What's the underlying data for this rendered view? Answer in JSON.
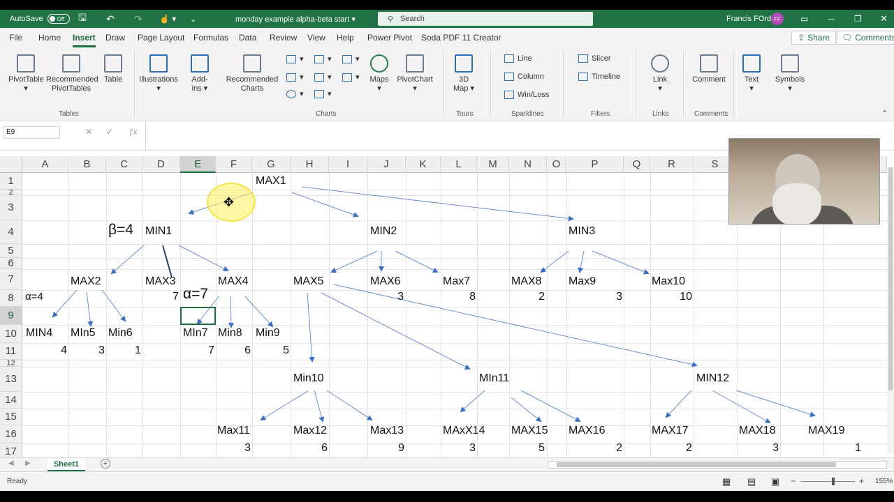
{
  "titlebar": {
    "autosave_label": "AutoSave",
    "autosave_state": "Off",
    "doc_title": "monday example alpha-beta start ▾",
    "search_placeholder": "Search",
    "user_name": "Francis FOrd",
    "user_initials": "FF"
  },
  "menu": [
    "File",
    "Home",
    "Insert",
    "Draw",
    "Page Layout",
    "Formulas",
    "Data",
    "Review",
    "View",
    "Help",
    "Power Pivot",
    "Soda PDF 11 Creator"
  ],
  "share_label": "Share",
  "comments_label": "Comments",
  "ribbon": {
    "pivottable": "PivotTable",
    "recommended_pivot": [
      "Recommended",
      "PivotTables"
    ],
    "table": "Table",
    "illustrations": "Illustrations",
    "addins": [
      "Add-",
      "ins ▾"
    ],
    "recommended_charts": [
      "Recommended",
      "Charts"
    ],
    "maps": "Maps",
    "pivotchart": "PivotChart",
    "map3d": [
      "3D",
      "Map ▾"
    ],
    "line": "Line",
    "column": "Column",
    "winloss": "Win/Loss",
    "slicer": "Slicer",
    "timeline": "Timeline",
    "link": "Link",
    "comment": "Comment",
    "text": "Text",
    "symbols": "Symbols",
    "groups": {
      "tables": "Tables",
      "charts": "Charts",
      "tours": "Tours",
      "sparklines": "Sparklines",
      "filters": "Filters",
      "links": "Links",
      "comments": "Comments"
    }
  },
  "namebox": "E9",
  "columns": [
    "A",
    "B",
    "C",
    "D",
    "E",
    "F",
    "G",
    "H",
    "I",
    "J",
    "K",
    "L",
    "M",
    "N",
    "O",
    "P",
    "Q",
    "R",
    "S"
  ],
  "rows": [
    "1",
    "2",
    "3",
    "4",
    "5",
    "6",
    "7",
    "8",
    "9",
    "10",
    "11",
    "12",
    "13",
    "14",
    "15",
    "16",
    "17"
  ],
  "cells": {
    "max1": "MAX1",
    "beta": "β=4",
    "min1": "MIN1",
    "min2": "MIN2",
    "min3": "MIN3",
    "max2": "MAX2",
    "max3": "MAX3",
    "max4": "MAX4",
    "max5": "MAX5",
    "max6": "MAX6",
    "max7": "Max7",
    "max8": "MAX8",
    "max9": "Max9",
    "max10": "Max10",
    "alpha4": "α=4",
    "d8": "7",
    "alpha7": "α=7",
    "j8": "3",
    "l8": "8",
    "n8": "2",
    "p8": "3",
    "r8": "10",
    "min4": "MIN4",
    "min5": "MIn5",
    "min6": "Min6",
    "min7": "MIn7",
    "min8": "Min8",
    "min9": "Min9",
    "a11": "4",
    "b11": "3",
    "c11": "1",
    "e11": "7",
    "f11": "6",
    "g11": "5",
    "min10": "Min10",
    "min11": "MIn11",
    "min12": "MIN12",
    "max11": "Max11",
    "max12": "Max12",
    "max13": "Max13",
    "max14": "MAxX14",
    "max15": "MAX15",
    "max16": "MAX16",
    "max17": "MAX17",
    "max18": "MAX18",
    "max19": "MAX19",
    "f17": "3",
    "h17": "6",
    "j17": "9",
    "l17": "3",
    "n17": "5",
    "p17": "2",
    "r17": "2",
    "t17": "3",
    "v17": "1"
  },
  "sheet_tab": "Sheet1",
  "status_text": "Ready",
  "zoom": "155%"
}
